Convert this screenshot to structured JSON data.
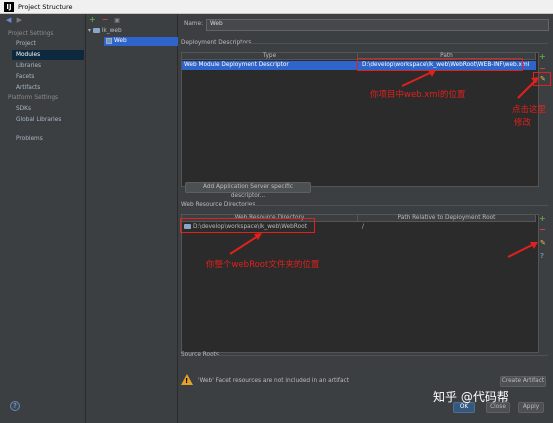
{
  "window": {
    "title": "Project Structure"
  },
  "left_nav": {
    "project_settings_header": "Project Settings",
    "project_settings": [
      "Project",
      "Modules",
      "Libraries",
      "Facets",
      "Artifacts"
    ],
    "platform_settings_header": "Platform Settings",
    "platform_settings": [
      "SDKs",
      "Global Libraries"
    ],
    "problems": "Problems",
    "selected": "Modules"
  },
  "tree": {
    "toolbar": {
      "add": "+",
      "remove": "−"
    },
    "module": "lk_web",
    "facet": "Web"
  },
  "facet": {
    "name_label": "Name:",
    "name_value": "Web",
    "deployment_descriptors": {
      "header": "Deployment Descriptors",
      "columns": [
        "Type",
        "Path"
      ],
      "row": {
        "type": "Web Module Deployment Descriptor",
        "path": "D:\\develop\\workspace\\lk_web\\WebRoot\\WEB-INF\\web.xml"
      },
      "add_server_descriptor": "Add Application Server specific descriptor..."
    },
    "web_resource_directories": {
      "header": "Web Resource Directories",
      "columns": [
        "Web Resource Directory",
        "Path Relative to Deployment Root"
      ],
      "row": {
        "directory": "D:\\develop\\workspace\\lk_web\\WebRoot",
        "relative_path": "/"
      }
    },
    "source_roots": {
      "header": "Source Roots"
    },
    "warning": "'Web' Facet resources are not included in an artifact",
    "create_artifact": "Create Artifact"
  },
  "footer": {
    "ok": "OK",
    "close": "Close",
    "apply": "Apply"
  },
  "annotations": {
    "webxml": "你项目中web.xml的位置",
    "click_edit_line1": "点击这里",
    "click_edit_line2": "修改",
    "webroot": "你整个webRoot文件夹的位置"
  },
  "watermark": "知乎 @代码帮",
  "colors": {
    "selection": "#2f65ca",
    "annotation_red": "#e0211c",
    "add_green": "#57a64a",
    "remove_red": "#d6443b",
    "warning_orange": "#e5a02b"
  },
  "icons": {
    "back": "back-arrow-icon",
    "forward": "forward-arrow-icon",
    "edit": "pencil-icon",
    "help": "question-icon",
    "warning": "warning-triangle-icon"
  }
}
